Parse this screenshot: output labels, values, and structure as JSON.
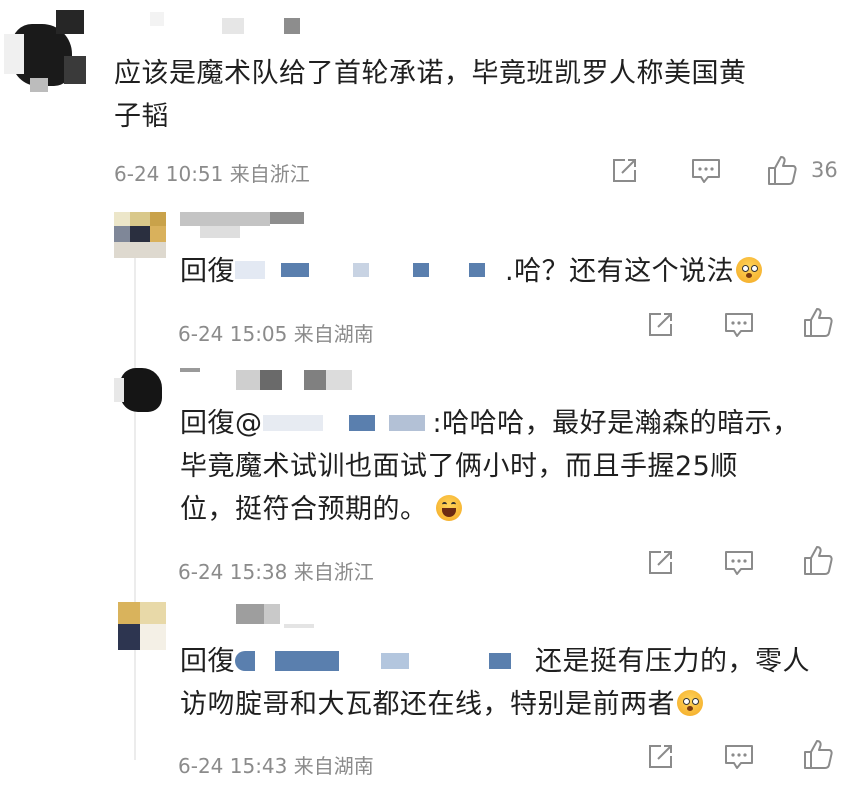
{
  "main_comment": {
    "text_line1": "应该是魔术队给了首轮承诺，毕竟班凯罗人称美国黄",
    "text_line2": "子韬",
    "meta": "6-24 10:51 来自浙江",
    "like_count": "36"
  },
  "replies": [
    {
      "prefix": "回復",
      "tail": ".哈？还有这个说法",
      "emoji": "flushed-emoji",
      "meta": "6-24 15:05 来自湖南"
    },
    {
      "prefix": "回復@",
      "line1_tail": ":哈哈哈，最好是瀚森的暗示，",
      "line2": "毕竟魔术试训也面试了俩小时，而且手握25顺",
      "line3": "位，挺符合预期的。",
      "emoji": "laughing-emoji",
      "meta": "6-24 15:38 来自浙江"
    },
    {
      "prefix": "回復",
      "line1_tail": "还是挺有压力的，零人",
      "line2": "访吻腚哥和大瓦都还在线，特别是前两者",
      "emoji": "flushed-emoji",
      "meta": "6-24 15:43 来自湖南"
    }
  ],
  "colors": {
    "meta_gray": "#8b8b8b",
    "censor_blue": "#5a7fae",
    "censor_light": "#c8d3e3"
  },
  "icons": [
    "share-icon",
    "comment-icon",
    "like-icon"
  ]
}
